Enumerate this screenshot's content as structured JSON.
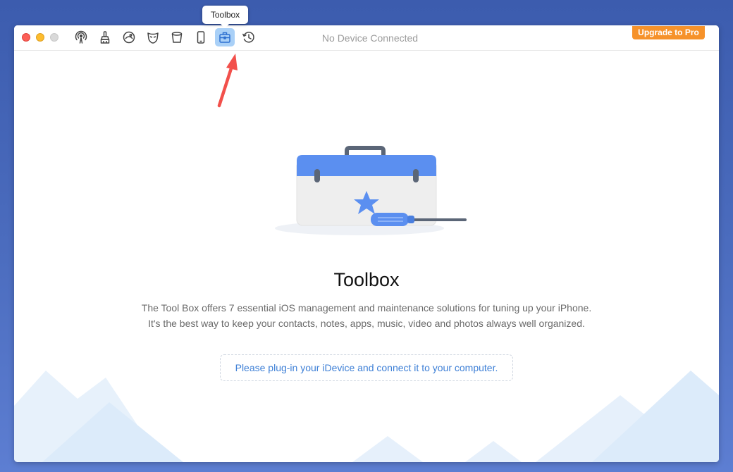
{
  "window": {
    "title": "No Device Connected",
    "upgrade_label": "Upgrade to Pro"
  },
  "toolbar": {
    "items": [
      {
        "name": "airplay-icon"
      },
      {
        "name": "cleaner-brush-icon"
      },
      {
        "name": "photo-sphere-icon"
      },
      {
        "name": "mask-icon"
      },
      {
        "name": "bucket-icon"
      },
      {
        "name": "phone-icon"
      },
      {
        "name": "toolbox-icon",
        "active": true
      },
      {
        "name": "history-clock-icon"
      }
    ],
    "tooltip": "Toolbox"
  },
  "main": {
    "title": "Toolbox",
    "description_line1": "The Tool Box offers 7 essential iOS management and maintenance solutions for tuning up your iPhone.",
    "description_line2": "It's the best way to keep your contacts, notes, apps, music, video  and photos always well organized.",
    "plug_prompt": "Please plug-in your iDevice and connect it to your computer."
  },
  "colors": {
    "accent": "#3d7fd6",
    "upgrade": "#f6922a",
    "arrow": "#f2504b"
  }
}
